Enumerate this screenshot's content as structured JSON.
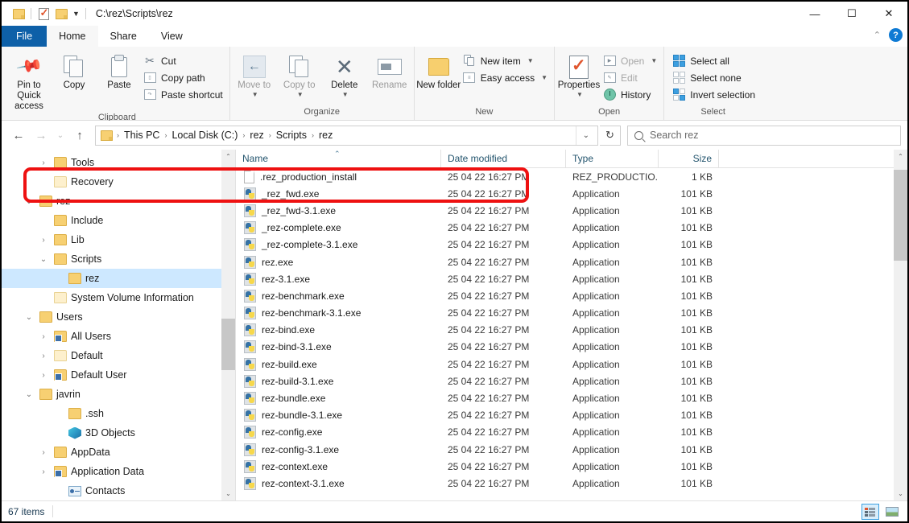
{
  "titlebar": {
    "path": "C:\\rez\\Scripts\\rez",
    "quick_access": [
      {
        "name": "folder-icon"
      },
      {
        "name": "properties-icon"
      },
      {
        "name": "folder-icon"
      }
    ],
    "controls": {
      "minimize": "—",
      "maximize": "☐",
      "close": "✕"
    }
  },
  "tabs": [
    {
      "label": "File",
      "id": "file"
    },
    {
      "label": "Home",
      "id": "home"
    },
    {
      "label": "Share",
      "id": "share"
    },
    {
      "label": "View",
      "id": "view"
    }
  ],
  "help": {
    "collapse": "⌃",
    "question": "?"
  },
  "ribbon": {
    "groups": [
      {
        "label": "Clipboard",
        "big": [
          {
            "label": "Pin to Quick access",
            "icon": "pin-icon"
          },
          {
            "label": "Copy",
            "icon": "copy-icon"
          },
          {
            "label": "Paste",
            "icon": "paste-icon"
          }
        ],
        "small": [
          {
            "label": "Cut",
            "icon": "scissors-icon"
          },
          {
            "label": "Copy path",
            "icon": "copy-path-icon"
          },
          {
            "label": "Paste shortcut",
            "icon": "paste-shortcut-icon"
          }
        ]
      },
      {
        "label": "Organize",
        "big": [
          {
            "label": "Move to",
            "icon": "move-to-icon",
            "dim": true
          },
          {
            "label": "Copy to",
            "icon": "copy-to-icon",
            "dim": true
          },
          {
            "label": "Delete",
            "icon": "delete-icon"
          },
          {
            "label": "Rename",
            "icon": "rename-icon",
            "dim": true
          }
        ]
      },
      {
        "label": "New",
        "big": [
          {
            "label": "New folder",
            "icon": "new-folder-icon"
          }
        ],
        "small": [
          {
            "label": "New item",
            "icon": "new-item-icon",
            "caret": true
          },
          {
            "label": "Easy access",
            "icon": "easy-access-icon",
            "caret": true
          }
        ]
      },
      {
        "label": "Open",
        "big": [
          {
            "label": "Properties",
            "icon": "properties-icon"
          }
        ],
        "small": [
          {
            "label": "Open",
            "icon": "open-icon",
            "dim": true,
            "caret": true
          },
          {
            "label": "Edit",
            "icon": "edit-icon",
            "dim": true
          },
          {
            "label": "History",
            "icon": "history-icon"
          }
        ]
      },
      {
        "label": "Select",
        "small": [
          {
            "label": "Select all",
            "icon": "select-all-icon"
          },
          {
            "label": "Select none",
            "icon": "select-none-icon"
          },
          {
            "label": "Invert selection",
            "icon": "invert-selection-icon"
          }
        ]
      }
    ]
  },
  "navigation": {
    "back": "←",
    "forward": "→",
    "recent": "⌄",
    "up": "↑",
    "refresh": "↻",
    "crumb_caret": "⌄",
    "breadcrumbs": [
      "This PC",
      "Local Disk (C:)",
      "rez",
      "Scripts",
      "rez"
    ],
    "separator": "›"
  },
  "search": {
    "placeholder": "Search rez",
    "icon": "search-icon"
  },
  "sidebar": {
    "items": [
      {
        "label": "Tools",
        "indent": 2,
        "twist": "›",
        "icon": "folder",
        "selected": false
      },
      {
        "label": "Recovery",
        "indent": 2,
        "twist": "",
        "icon": "folder-pale",
        "selected": false
      },
      {
        "label": "rez",
        "indent": 1,
        "twist": "⌄",
        "icon": "folder",
        "selected": false
      },
      {
        "label": "Include",
        "indent": 2,
        "twist": "",
        "icon": "folder",
        "selected": false
      },
      {
        "label": "Lib",
        "indent": 2,
        "twist": "›",
        "icon": "folder",
        "selected": false
      },
      {
        "label": "Scripts",
        "indent": 2,
        "twist": "⌄",
        "icon": "folder",
        "selected": false
      },
      {
        "label": "rez",
        "indent": 3,
        "twist": "",
        "icon": "folder",
        "selected": true
      },
      {
        "label": "System Volume Information",
        "indent": 2,
        "twist": "",
        "icon": "folder-pale",
        "selected": false
      },
      {
        "label": "Users",
        "indent": 1,
        "twist": "⌄",
        "icon": "folder",
        "selected": false
      },
      {
        "label": "All Users",
        "indent": 2,
        "twist": "›",
        "icon": "folder-shortcut",
        "selected": false
      },
      {
        "label": "Default",
        "indent": 2,
        "twist": "›",
        "icon": "folder-pale",
        "selected": false
      },
      {
        "label": "Default User",
        "indent": 2,
        "twist": "›",
        "icon": "folder-shortcut",
        "selected": false
      },
      {
        "label": "javrin",
        "indent": 1,
        "twist": "⌄",
        "icon": "folder",
        "selected": false
      },
      {
        "label": ".ssh",
        "indent": 3,
        "twist": "",
        "icon": "folder",
        "selected": false
      },
      {
        "label": "3D Objects",
        "indent": 3,
        "twist": "",
        "icon": "cube",
        "selected": false
      },
      {
        "label": "AppData",
        "indent": 2,
        "twist": "›",
        "icon": "folder",
        "selected": false
      },
      {
        "label": "Application Data",
        "indent": 2,
        "twist": "›",
        "icon": "folder-shortcut",
        "selected": false
      },
      {
        "label": "Contacts",
        "indent": 3,
        "twist": "",
        "icon": "contacts",
        "selected": false
      }
    ]
  },
  "filelist": {
    "columns": [
      "Name",
      "Date modified",
      "Type",
      "Size"
    ],
    "sort_indicator": "⌃",
    "rows": [
      {
        "name": ".rez_production_install",
        "date": "25 04 22 16:27 PM",
        "type": "REZ_PRODUCTIO...",
        "size": "1 KB",
        "icon": "file"
      },
      {
        "name": "_rez_fwd.exe",
        "date": "25 04 22 16:27 PM",
        "type": "Application",
        "size": "101 KB",
        "icon": "python"
      },
      {
        "name": "_rez_fwd-3.1.exe",
        "date": "25 04 22 16:27 PM",
        "type": "Application",
        "size": "101 KB",
        "icon": "python"
      },
      {
        "name": "_rez-complete.exe",
        "date": "25 04 22 16:27 PM",
        "type": "Application",
        "size": "101 KB",
        "icon": "python"
      },
      {
        "name": "_rez-complete-3.1.exe",
        "date": "25 04 22 16:27 PM",
        "type": "Application",
        "size": "101 KB",
        "icon": "python"
      },
      {
        "name": "rez.exe",
        "date": "25 04 22 16:27 PM",
        "type": "Application",
        "size": "101 KB",
        "icon": "python"
      },
      {
        "name": "rez-3.1.exe",
        "date": "25 04 22 16:27 PM",
        "type": "Application",
        "size": "101 KB",
        "icon": "python"
      },
      {
        "name": "rez-benchmark.exe",
        "date": "25 04 22 16:27 PM",
        "type": "Application",
        "size": "101 KB",
        "icon": "python"
      },
      {
        "name": "rez-benchmark-3.1.exe",
        "date": "25 04 22 16:27 PM",
        "type": "Application",
        "size": "101 KB",
        "icon": "python"
      },
      {
        "name": "rez-bind.exe",
        "date": "25 04 22 16:27 PM",
        "type": "Application",
        "size": "101 KB",
        "icon": "python"
      },
      {
        "name": "rez-bind-3.1.exe",
        "date": "25 04 22 16:27 PM",
        "type": "Application",
        "size": "101 KB",
        "icon": "python"
      },
      {
        "name": "rez-build.exe",
        "date": "25 04 22 16:27 PM",
        "type": "Application",
        "size": "101 KB",
        "icon": "python"
      },
      {
        "name": "rez-build-3.1.exe",
        "date": "25 04 22 16:27 PM",
        "type": "Application",
        "size": "101 KB",
        "icon": "python"
      },
      {
        "name": "rez-bundle.exe",
        "date": "25 04 22 16:27 PM",
        "type": "Application",
        "size": "101 KB",
        "icon": "python"
      },
      {
        "name": "rez-bundle-3.1.exe",
        "date": "25 04 22 16:27 PM",
        "type": "Application",
        "size": "101 KB",
        "icon": "python"
      },
      {
        "name": "rez-config.exe",
        "date": "25 04 22 16:27 PM",
        "type": "Application",
        "size": "101 KB",
        "icon": "python"
      },
      {
        "name": "rez-config-3.1.exe",
        "date": "25 04 22 16:27 PM",
        "type": "Application",
        "size": "101 KB",
        "icon": "python"
      },
      {
        "name": "rez-context.exe",
        "date": "25 04 22 16:27 PM",
        "type": "Application",
        "size": "101 KB",
        "icon": "python"
      },
      {
        "name": "rez-context-3.1.exe",
        "date": "25 04 22 16:27 PM",
        "type": "Application",
        "size": "101 KB",
        "icon": "python"
      }
    ]
  },
  "annotation": {
    "color": "#ee1111",
    "target_row": ".rez_production_install"
  },
  "statusbar": {
    "item_count": "67 items",
    "views": [
      {
        "name": "details-view",
        "active": true
      },
      {
        "name": "large-icons-view",
        "active": false
      }
    ]
  },
  "scrollbars": {
    "up_arrow": "⌃",
    "down_arrow": "⌄"
  }
}
